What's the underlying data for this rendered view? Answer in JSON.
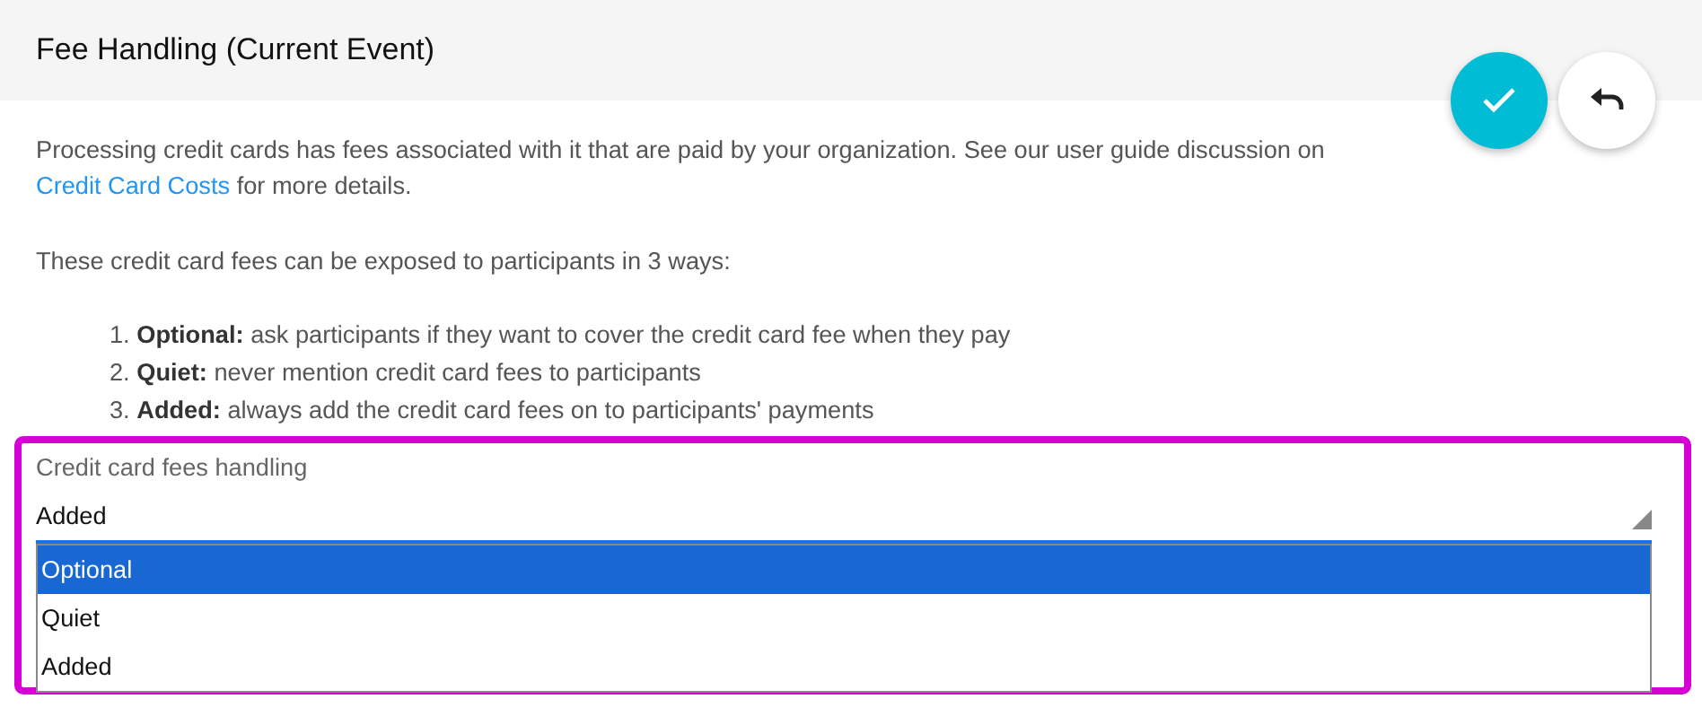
{
  "header": {
    "title": "Fee Handling (Current Event)"
  },
  "actions": [
    {
      "kind": "confirm"
    },
    {
      "kind": "undo"
    }
  ],
  "intro": {
    "before": "Processing credit cards has fees associated with it that are paid by your organization. See our user guide discussion on",
    "link": "Credit Card Costs",
    "after": "for more details."
  },
  "ways_intro": "These credit card fees can be exposed to participants in 3 ways:",
  "ways": [
    {
      "number": "1.",
      "term": "Optional:",
      "description": "ask participants if they want to cover the credit card fee when they pay"
    },
    {
      "number": "2.",
      "term": "Quiet:",
      "description": "never mention credit card fees to participants"
    },
    {
      "number": "3.",
      "term": "Added:",
      "description": "always add the credit card fees on to participants' payments"
    }
  ],
  "field": {
    "label": "Credit card fees handling",
    "value": "Added",
    "expanded": true,
    "options": [
      {
        "label": "Optional",
        "highlighted": true
      },
      {
        "label": "Quiet",
        "highlighted": false
      },
      {
        "label": "Added",
        "highlighted": false
      }
    ]
  }
}
